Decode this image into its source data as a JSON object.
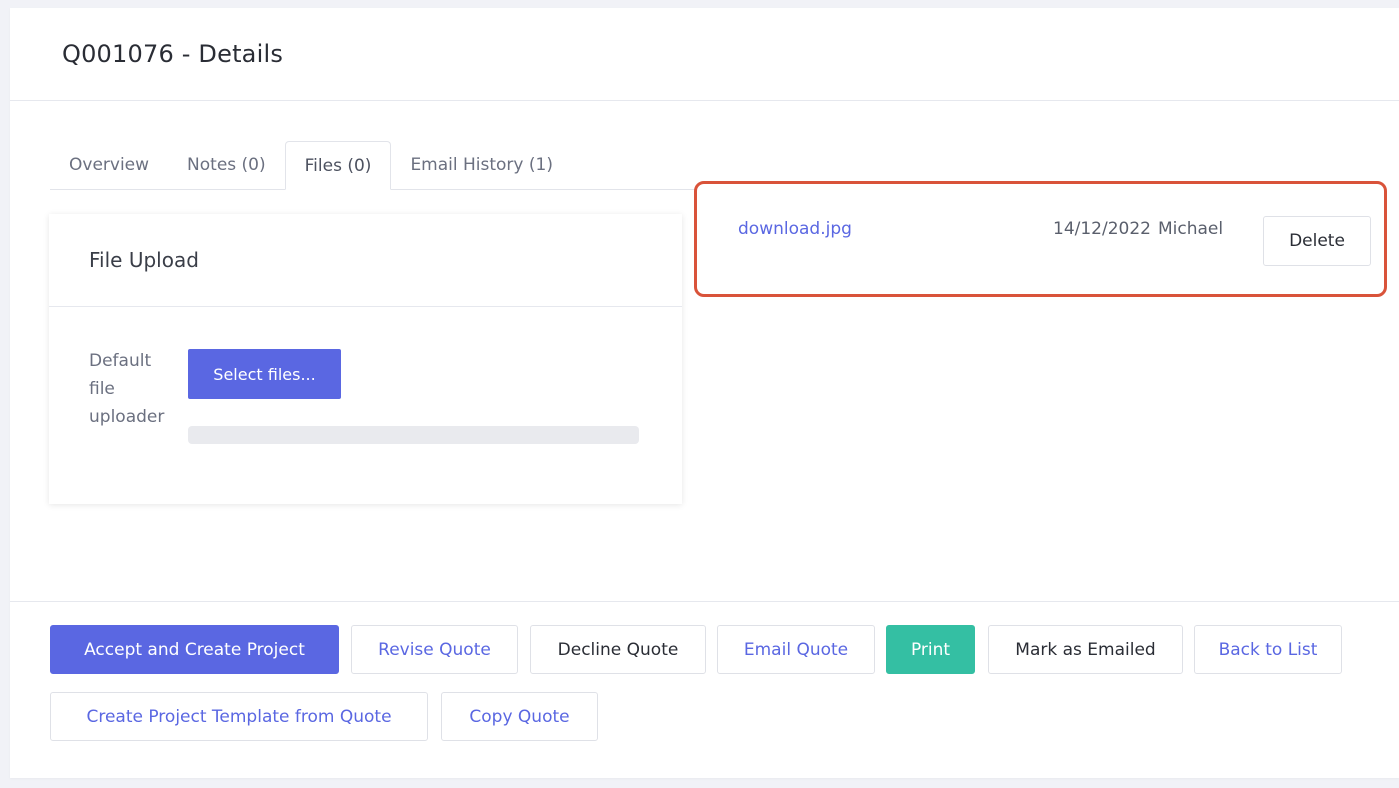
{
  "page": {
    "title": "Q001076 - Details"
  },
  "tabs": [
    {
      "label": "Overview",
      "active": false
    },
    {
      "label": "Notes (0)",
      "active": false
    },
    {
      "label": "Files (0)",
      "active": true
    },
    {
      "label": "Email History (1)",
      "active": false
    }
  ],
  "upload": {
    "title": "File Upload",
    "uploader_label": "Default file uploader",
    "select_button": "Select files...",
    "progress": 0
  },
  "file": {
    "name": "download.jpg",
    "date": "14/12/2022",
    "user": "Michael",
    "delete_label": "Delete"
  },
  "actions": {
    "accept": "Accept and Create Project",
    "revise": "Revise Quote",
    "decline": "Decline Quote",
    "email": "Email Quote",
    "print": "Print",
    "mark_emailed": "Mark as Emailed",
    "back": "Back to List",
    "create_template": "Create Project Template from Quote",
    "copy": "Copy Quote"
  },
  "colors": {
    "accent": "#5a67e2",
    "success": "#34bfa3",
    "highlight": "#d9533a"
  }
}
